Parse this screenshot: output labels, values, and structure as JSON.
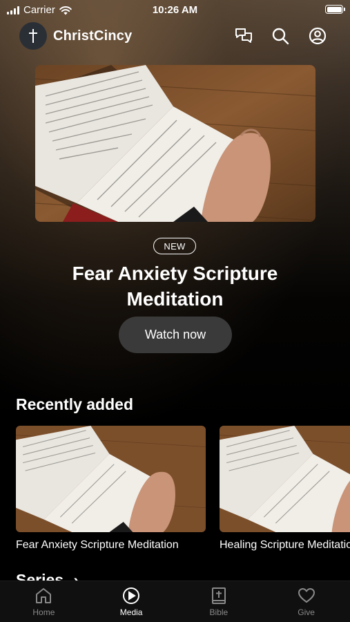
{
  "status_bar": {
    "carrier": "Carrier",
    "time": "10:26 AM",
    "battery_level": 1.0
  },
  "header": {
    "app_name": "ChristCincy",
    "logo_icon": "cross-icon",
    "actions": [
      {
        "icon": "chat-icon"
      },
      {
        "icon": "search-icon"
      },
      {
        "icon": "profile-icon"
      }
    ]
  },
  "hero": {
    "badge": "NEW",
    "title": "Fear Anxiety Scripture Meditation",
    "button_label": "Watch now",
    "image": "open-bible-on-wooden-table"
  },
  "recently_added": {
    "title": "Recently added",
    "items": [
      {
        "title": "Fear Anxiety Scripture Meditation",
        "image": "open-bible-on-wooden-table"
      },
      {
        "title": "Healing Scripture Meditation",
        "image": "open-bible-on-wooden-table"
      }
    ]
  },
  "series": {
    "title": "Series",
    "arrow": "›"
  },
  "tabs": [
    {
      "label": "Home",
      "icon": "home-icon",
      "active": false
    },
    {
      "label": "Media",
      "icon": "play-icon",
      "active": true
    },
    {
      "label": "Bible",
      "icon": "bible-icon",
      "active": false
    },
    {
      "label": "Give",
      "icon": "heart-icon",
      "active": false
    }
  ],
  "colors": {
    "background": "#000000",
    "button_bg": "#3a3a3a",
    "tab_inactive": "#8a8a8a",
    "tab_active": "#ffffff"
  }
}
